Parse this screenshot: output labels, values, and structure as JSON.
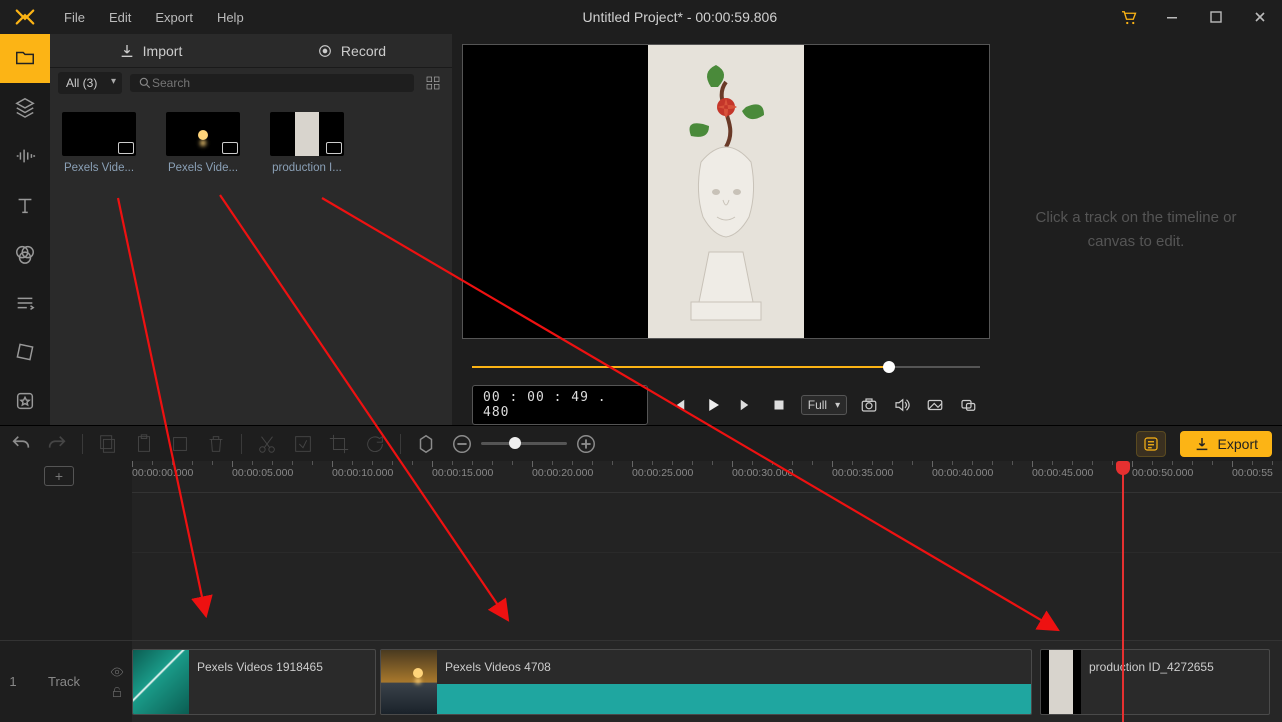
{
  "app": {
    "title": "Untitled Project* - 00:00:59.806"
  },
  "menu": {
    "items": [
      "File",
      "Edit",
      "Export",
      "Help"
    ]
  },
  "mediaTabs": {
    "import": "Import",
    "record": "Record"
  },
  "mediaFilter": {
    "all": "All (3)",
    "searchPlaceholder": "Search"
  },
  "mediaItems": [
    {
      "label": "Pexels Vide..."
    },
    {
      "label": "Pexels Vide..."
    },
    {
      "label": "production I..."
    }
  ],
  "preview": {
    "timecode": "00 : 00 : 49 . 480",
    "scrubPercent": 82,
    "sizeMode": "Full"
  },
  "rightHint": "Click a track on the timeline or canvas to edit.",
  "toolbar": {
    "export": "Export",
    "zoomPercent": 32
  },
  "timeline": {
    "addIcon": "+",
    "trackIndex": "1",
    "trackName": "Track",
    "pxPerSec": 20,
    "playheadSec": 49.48,
    "ruler": [
      "00:00:00.000",
      "00:00:05.000",
      "00:00:10.000",
      "00:00:15.000",
      "00:00:20.000",
      "00:00:25.000",
      "00:00:30.000",
      "00:00:35.000",
      "00:00:40.000",
      "00:00:45.000",
      "00:00:50.000",
      "00:00:55"
    ],
    "clips": [
      {
        "title": "Pexels Videos 1918465",
        "startSec": 0,
        "durSec": 12.2,
        "thumb": "wave",
        "hasAudio": false
      },
      {
        "title": "Pexels Videos 4708",
        "startSec": 12.4,
        "durSec": 32.6,
        "thumb": "sunset",
        "hasAudio": true
      },
      {
        "title": "production ID_4272655",
        "startSec": 45.4,
        "durSec": 11.5,
        "thumb": "statue",
        "hasAudio": false
      }
    ]
  }
}
